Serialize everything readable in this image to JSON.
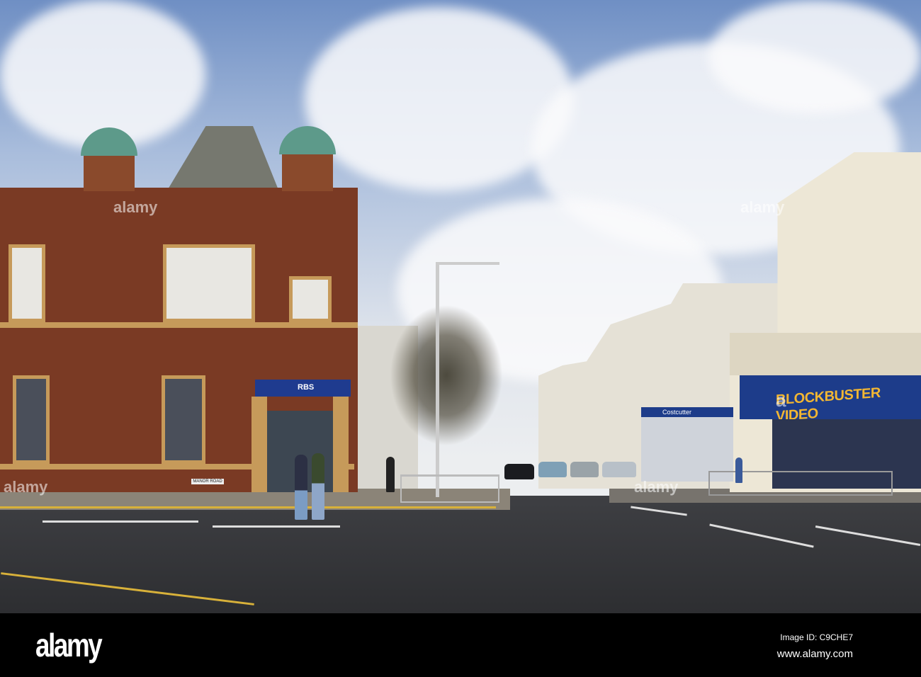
{
  "signs": {
    "bank": "RBS",
    "street": "MANOR ROAD",
    "store": "BLOCKBUSTER VIDEO",
    "shop": "Costcutter"
  },
  "watermark": {
    "logo": "alamy",
    "overlay": "a",
    "image_id": "Image ID: C9CHE7",
    "url": "www.alamy.com"
  },
  "colors": {
    "brick": "#7a3a24",
    "rbs_blue": "#1f3b8f",
    "blockbuster_blue": "#1d3c8a",
    "blockbuster_yellow": "#f2b632",
    "dome_green": "#5d9a8a"
  }
}
